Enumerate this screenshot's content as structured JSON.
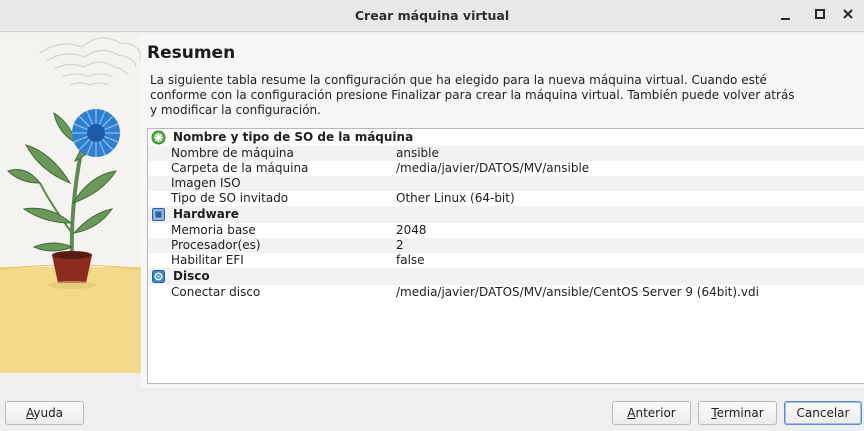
{
  "window": {
    "title": "Crear máquina virtual",
    "controls": [
      "minimize-icon",
      "maximize-icon",
      "close-icon"
    ]
  },
  "page": {
    "heading": "Resumen",
    "description": "La siguiente tabla resume la configuración que ha elegido para la nueva máquina virtual. Cuando esté conforme con la configuración presione Finalizar para crear la máquina virtual. También puede volver atrás y modificar la configuración."
  },
  "summary": {
    "general": {
      "title": "Nombre y tipo de SO de la máquina",
      "icon": "general-settings-icon",
      "rows": [
        {
          "key": "Nombre de máquina",
          "value": "ansible"
        },
        {
          "key": "Carpeta de la máquina",
          "value": "/media/javier/DATOS/MV/ansible"
        },
        {
          "key": "Imagen ISO",
          "value": ""
        },
        {
          "key": "Tipo de SO invitado",
          "value": "Other Linux (64-bit)"
        }
      ]
    },
    "hardware": {
      "title": "Hardware",
      "icon": "chip-icon",
      "rows": [
        {
          "key": "Memoria base",
          "value": "2048"
        },
        {
          "key": "Procesador(es)",
          "value": "2"
        },
        {
          "key": "Habilitar EFI",
          "value": "false"
        }
      ]
    },
    "disk": {
      "title": "Disco",
      "icon": "hard-disk-icon",
      "rows": [
        {
          "key": "Conectar disco",
          "value": "/media/javier/DATOS/MV/ansible/CentOS Server 9 (64bit).vdi"
        }
      ]
    }
  },
  "buttons": {
    "help": {
      "mnemonic": "A",
      "rest": "yuda"
    },
    "back": {
      "mnemonic": "A",
      "rest": "nterior"
    },
    "finish": {
      "mnemonic": "T",
      "rest": "erminar"
    },
    "cancel": {
      "mnemonic": "",
      "rest": "Cancelar"
    }
  },
  "colors": {
    "focus_border": "#5b8fd1",
    "flower_blue": "#2f7fd0",
    "pot": "#8a2b1e",
    "art_yellow": "#f3d98a"
  }
}
